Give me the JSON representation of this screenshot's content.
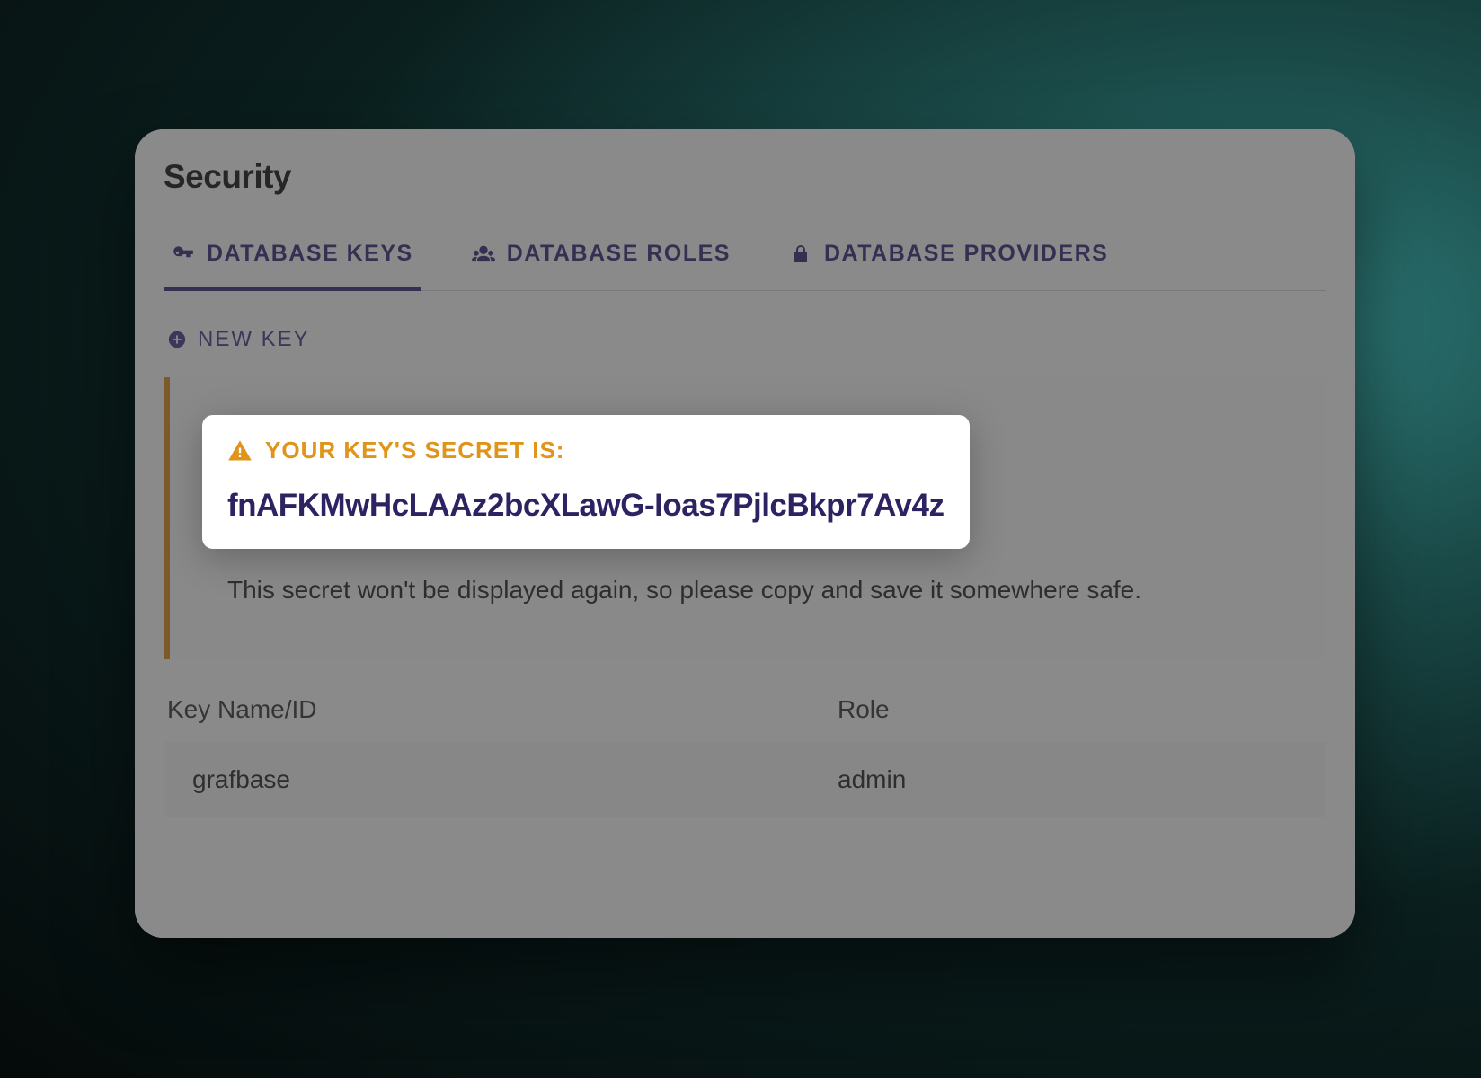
{
  "page": {
    "title": "Security"
  },
  "tabs": [
    {
      "label": "DATABASE KEYS",
      "active": true
    },
    {
      "label": "DATABASE ROLES",
      "active": false
    },
    {
      "label": "DATABASE PROVIDERS",
      "active": false
    }
  ],
  "actions": {
    "new_key_label": "NEW KEY"
  },
  "alert": {
    "heading": "YOUR KEY'S SECRET IS:",
    "secret": "fnAFKMwHcLAAz2bcXLawG-Ioas7PjlcBkpr7Av4z",
    "hint": "This secret won't be displayed again, so please copy and save it somewhere safe."
  },
  "table": {
    "columns": {
      "name": "Key Name/ID",
      "role": "Role"
    },
    "rows": [
      {
        "name": "grafbase",
        "role": "admin"
      }
    ]
  },
  "colors": {
    "accent": "#3b2f7a",
    "warning": "#e0941a"
  }
}
